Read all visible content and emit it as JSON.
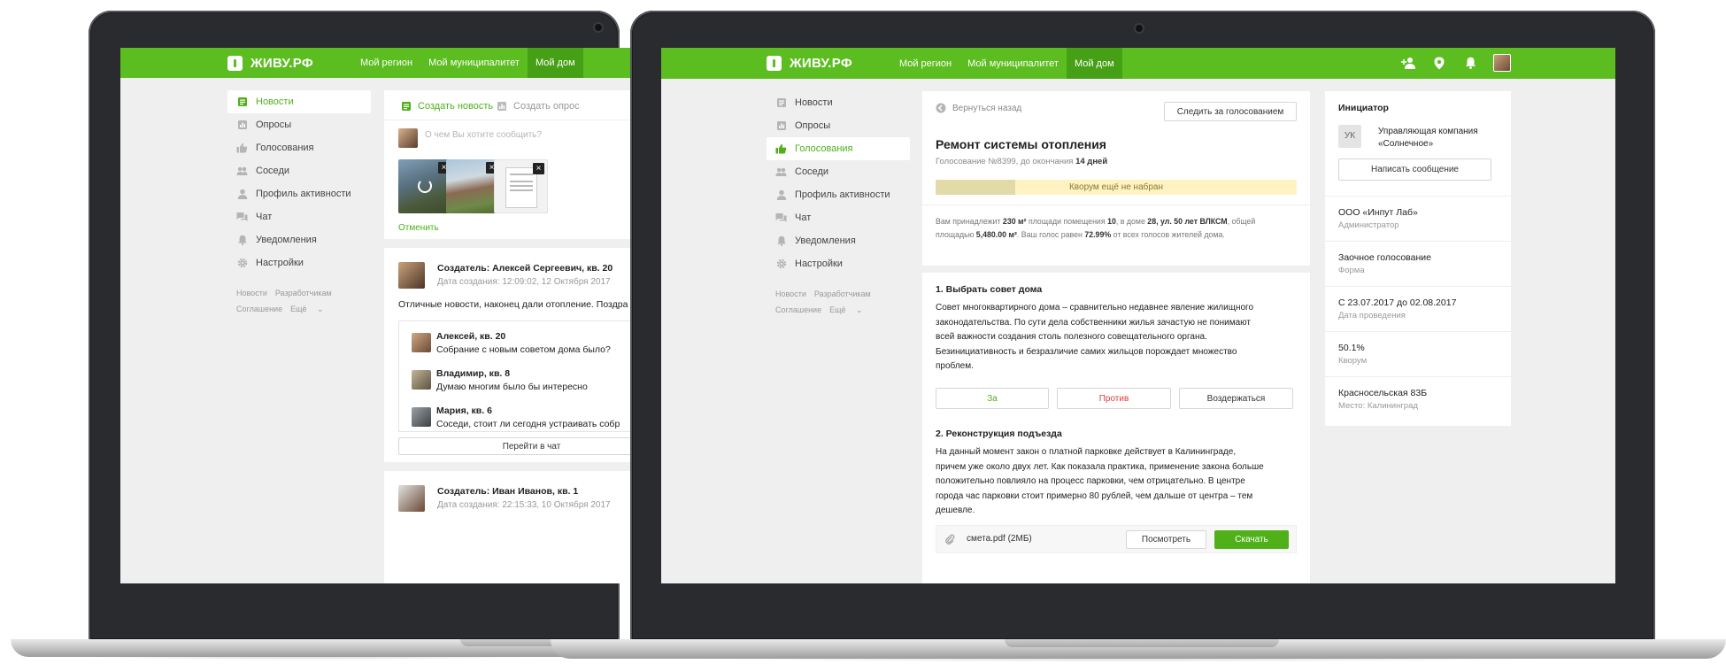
{
  "brand": {
    "logo_text": "ЖИВУ.РФ",
    "accent": "#5bbd1f",
    "accent_dark": "#45a015"
  },
  "topnav": {
    "items": [
      "Мой регион",
      "Мой муниципалитет",
      "Мой дом"
    ],
    "active": "Мой дом"
  },
  "sidebar": {
    "items": [
      {
        "label": "Новости",
        "icon": "news-icon"
      },
      {
        "label": "Опросы",
        "icon": "poll-icon"
      },
      {
        "label": "Голосования",
        "icon": "thumbs-up-icon"
      },
      {
        "label": "Соседи",
        "icon": "neighbors-icon"
      },
      {
        "label": "Профиль активности",
        "icon": "profile-icon"
      },
      {
        "label": "Чат",
        "icon": "chat-icon"
      },
      {
        "label": "Уведомления",
        "icon": "bell-icon"
      },
      {
        "label": "Настройки",
        "icon": "gear-icon"
      }
    ],
    "footer_links": [
      "Новости",
      "Разработчикам"
    ],
    "footer_links2": [
      "Соглашение",
      "Ещё"
    ]
  },
  "left_screen": {
    "tab_create_news": "Создать новость",
    "tab_create_poll": "Создать опрос",
    "composer_placeholder": "О чем Вы хотите сообщить?",
    "cancel_label": "Отменить",
    "post1": {
      "author": "Создатель: Алексей Сергеевич, кв. 20",
      "date": "Дата создания: 12:09:02, 12 Октября 2017",
      "text": "Отличные новости, наконец дали отопление. Поздра"
    },
    "comments": [
      {
        "name": "Алексей, кв. 20",
        "text": "Собрание с новым советом дома было?"
      },
      {
        "name": "Владимир, кв. 8",
        "text": "Думаю многим было бы интересно"
      },
      {
        "name": "Мария, кв. 6",
        "text": "Соседи, стоит ли сегодня устраивать собр"
      }
    ],
    "go_to_chat": "Перейти в чат",
    "post2": {
      "author": "Создатель: Иван Иванов, кв. 1",
      "date": "Дата создания: 22:15:33, 10 Октября 2017"
    }
  },
  "vote": {
    "back_label": "Вернуться назад",
    "follow_button": "Следить за голосованием",
    "title": "Ремонт системы отопления",
    "subtitle_prefix": "Голосование №8399, до окончания",
    "subtitle_days": "14 дней",
    "quorum_label": "Кворум ещё не набран",
    "quorum_fraction": 0.22,
    "ownership_line1_a": "Вам принадлежит",
    "ownership_area": "230 м²",
    "ownership_line1_b": "площади помещения",
    "ownership_flat": "10",
    "ownership_line1_c": ", в доме",
    "ownership_address": "28, ул. 50 лет ВЛКСМ",
    "ownership_line1_d": ", общей",
    "ownership_line2_a": "площадью",
    "ownership_total": "5,480.00 м²",
    "ownership_line2_b": ". Ваш голос равен",
    "ownership_percent": "72.99%",
    "ownership_line2_c": "от всех голосов жителей дома.",
    "q1_title": "1. Выбрать совет дома",
    "q1_lines": [
      "Совет многоквартирного дома – сравнительно недавнее явление жилищного",
      "законодательства. По сути дела собственники жилья зачастую не понимают",
      "всей важности создания столь полезного совещательного органа.",
      "Безинициативность и безразличие самих жильцов порождает множество",
      "проблем."
    ],
    "btn_for": "За",
    "btn_against": "Против",
    "btn_abstain": "Воздержаться",
    "q2_title": "2. Реконструкция подъезда",
    "q2_lines": [
      "На данный момент закон о платной парковке действует в Калининграде,",
      "причем уже около двух лет. Как показала практика, применение закона больше",
      "положительно повлияло на процесс парковки, чем отрицательно. В центре",
      "города час парковки стоит примерно 80 рублей, чем дальше от центра – тем",
      "дешевле."
    ],
    "attachment_name": "смета.pdf (2МБ)",
    "btn_view": "Посмотреть",
    "btn_download": "Скачать"
  },
  "initiator": {
    "heading": "Инициатор",
    "avatar_text": "УК",
    "org_name_line1": "Управляющая компания",
    "org_name_line2": "«Солнечное»",
    "message_button": "Написать сообщение",
    "rows": [
      {
        "value": "ООО «Инпут Лаб»",
        "label": "Администратор"
      },
      {
        "value": "Заочное голосование",
        "label": "Форма"
      },
      {
        "value": "С 23.07.2017 до 02.08.2017",
        "label": "Дата проведения"
      },
      {
        "value": "50.1%",
        "label": "Кворум"
      },
      {
        "value": "Красносельская 83Б",
        "label": "Место: Калининград"
      }
    ]
  }
}
